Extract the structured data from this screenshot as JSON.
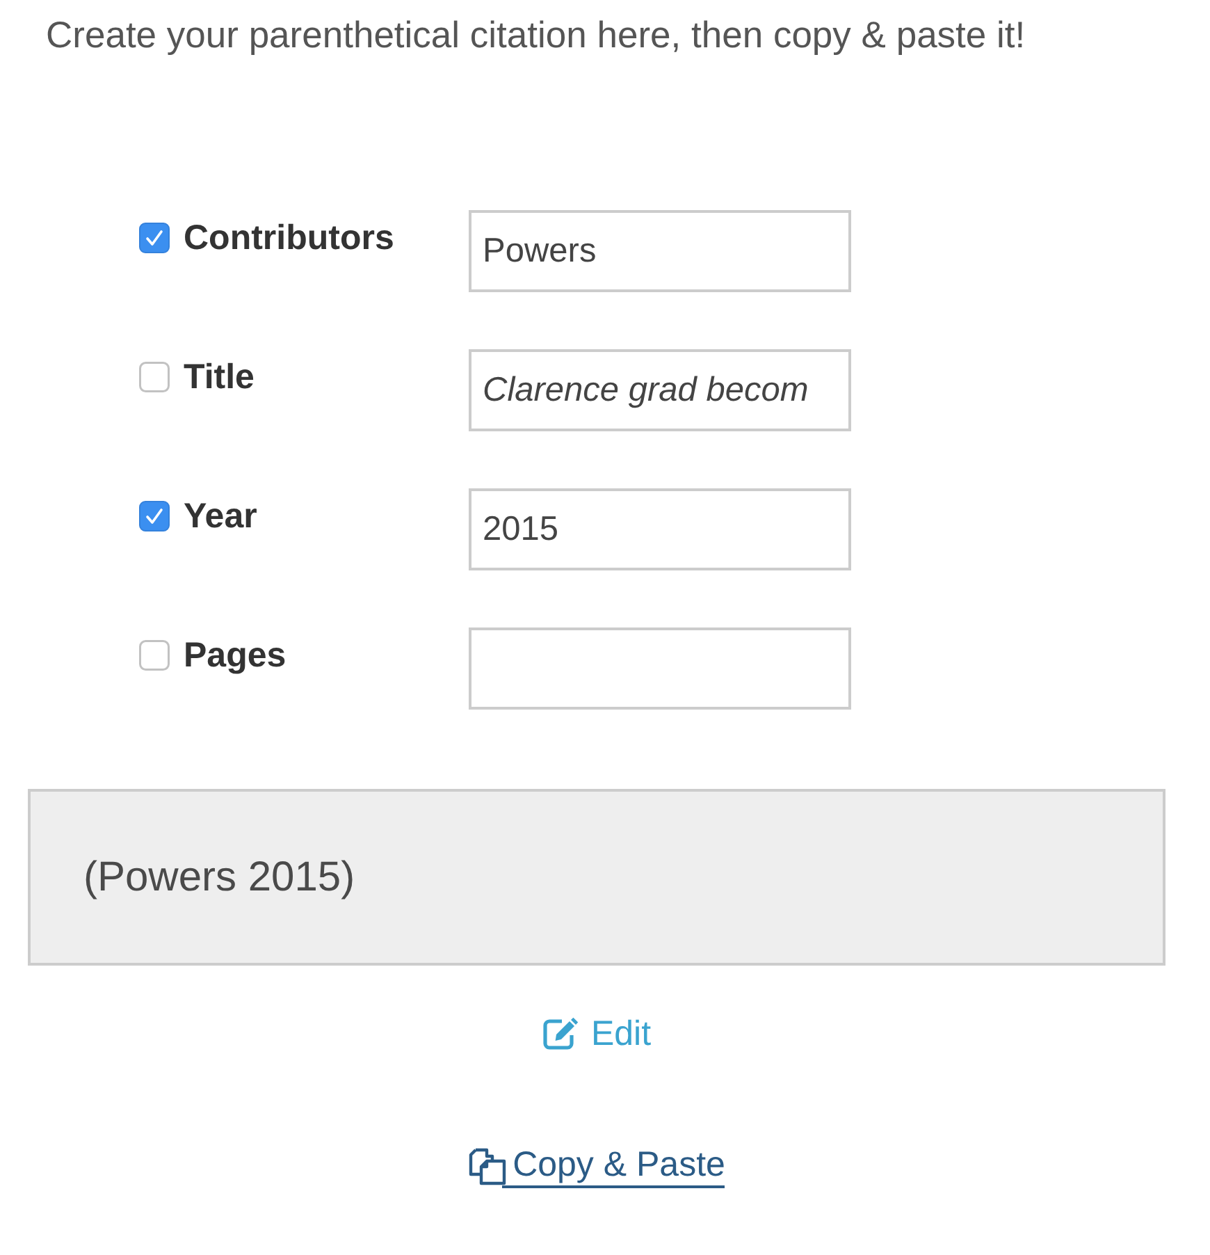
{
  "heading": "Create your parenthetical citation here, then copy & paste it!",
  "fields": [
    {
      "label": "Contributors",
      "checked": true,
      "kind": "plain",
      "value": "Powers"
    },
    {
      "label": "Title",
      "checked": false,
      "kind": "italic",
      "value": "Clarence grad becom"
    },
    {
      "label": "Year",
      "checked": true,
      "kind": "plain",
      "value": "2015"
    },
    {
      "label": "Pages",
      "checked": false,
      "kind": "plain"
    }
  ],
  "citation": "(Powers 2015)",
  "links": [
    {
      "kind": "edit",
      "label": "Edit"
    },
    {
      "kind": "copy",
      "label": "Copy & Paste"
    }
  ]
}
